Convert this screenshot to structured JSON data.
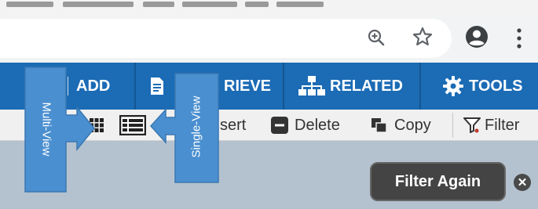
{
  "toolbar": {
    "add_label": "ADD",
    "retrieve_label": "RIEVE",
    "related_label": "RELATED",
    "tools_label": "TOOLS"
  },
  "actions": {
    "insert_label": "sert",
    "delete_label": "Delete",
    "copy_label": "Copy",
    "filter_label": "Filter"
  },
  "callouts": {
    "multi_view": "Multi-View",
    "single_view": "Single-View"
  },
  "filter_again_label": "Filter Again",
  "colors": {
    "toolbar_blue": "#1b6bb5",
    "callout_blue": "#4a8fd0",
    "content_bg": "#b4c2cf",
    "filter_button_bg": "#444444"
  },
  "icons": [
    "zoom-icon",
    "star-icon",
    "account-icon",
    "more-vert-icon",
    "retrieve-doc-icon",
    "related-sitemap-icon",
    "gear-icon",
    "grid-view-icon",
    "list-view-icon",
    "delete-icon",
    "copy-icon",
    "filter-icon",
    "close-circle-icon"
  ]
}
